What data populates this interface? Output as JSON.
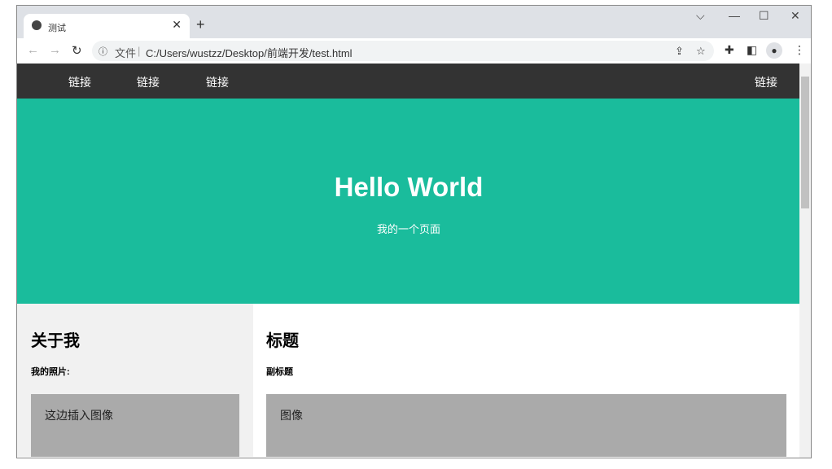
{
  "browser": {
    "tab_title": "测试",
    "address_scheme": "文件",
    "url": "C:/Users/wustzz/Desktop/前端开发/test.html"
  },
  "nav": {
    "links": [
      "链接",
      "链接",
      "链接"
    ],
    "right_link": "链接"
  },
  "hero": {
    "title": "Hello World",
    "subtitle": "我的一个页面"
  },
  "sidebar": {
    "heading": "关于我",
    "subheading": "我的照片:",
    "image_placeholder": "这边插入图像"
  },
  "main": {
    "heading": "标题",
    "subheading": "副标题",
    "image_placeholder": "图像"
  },
  "colors": {
    "nav": "#333333",
    "hero": "#1abc9c",
    "sidebar": "#f1f1f1",
    "image": "#aaaaaa"
  }
}
